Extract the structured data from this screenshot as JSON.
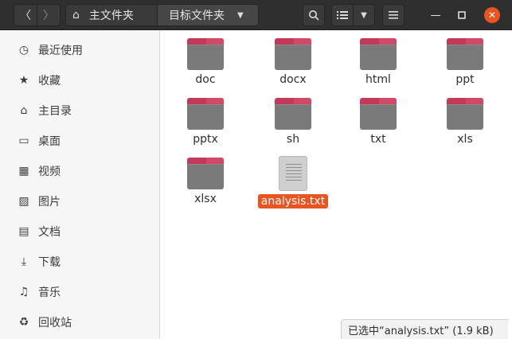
{
  "header": {
    "back_icon": "chevron-left-icon",
    "forward_icon": "chevron-right-icon",
    "path_home": "主文件夹",
    "path_current": "目标文件夹"
  },
  "sidebar": {
    "items": [
      {
        "label": "最近使用",
        "icon": "clock-icon"
      },
      {
        "label": "收藏",
        "icon": "star-icon"
      },
      {
        "label": "主目录",
        "icon": "home-icon"
      },
      {
        "label": "桌面",
        "icon": "desktop-icon"
      },
      {
        "label": "视频",
        "icon": "video-icon"
      },
      {
        "label": "图片",
        "icon": "image-icon"
      },
      {
        "label": "文档",
        "icon": "document-icon"
      },
      {
        "label": "下载",
        "icon": "download-icon"
      },
      {
        "label": "音乐",
        "icon": "music-icon"
      },
      {
        "label": "回收站",
        "icon": "trash-icon"
      }
    ]
  },
  "files": [
    {
      "name": "doc",
      "type": "folder"
    },
    {
      "name": "docx",
      "type": "folder"
    },
    {
      "name": "html",
      "type": "folder"
    },
    {
      "name": "ppt",
      "type": "folder"
    },
    {
      "name": "pptx",
      "type": "folder"
    },
    {
      "name": "sh",
      "type": "folder"
    },
    {
      "name": "txt",
      "type": "folder"
    },
    {
      "name": "xls",
      "type": "folder"
    },
    {
      "name": "xlsx",
      "type": "folder"
    },
    {
      "name": "analysis.txt",
      "type": "text-file",
      "selected": true
    }
  ],
  "status": {
    "text": "已选中“analysis.txt” (1.9 kB)"
  },
  "colors": {
    "accent": "#e95420",
    "headerbar": "#2f2f2f",
    "folder_tab": "#c4385a",
    "folder_body": "#7a7a7a"
  }
}
